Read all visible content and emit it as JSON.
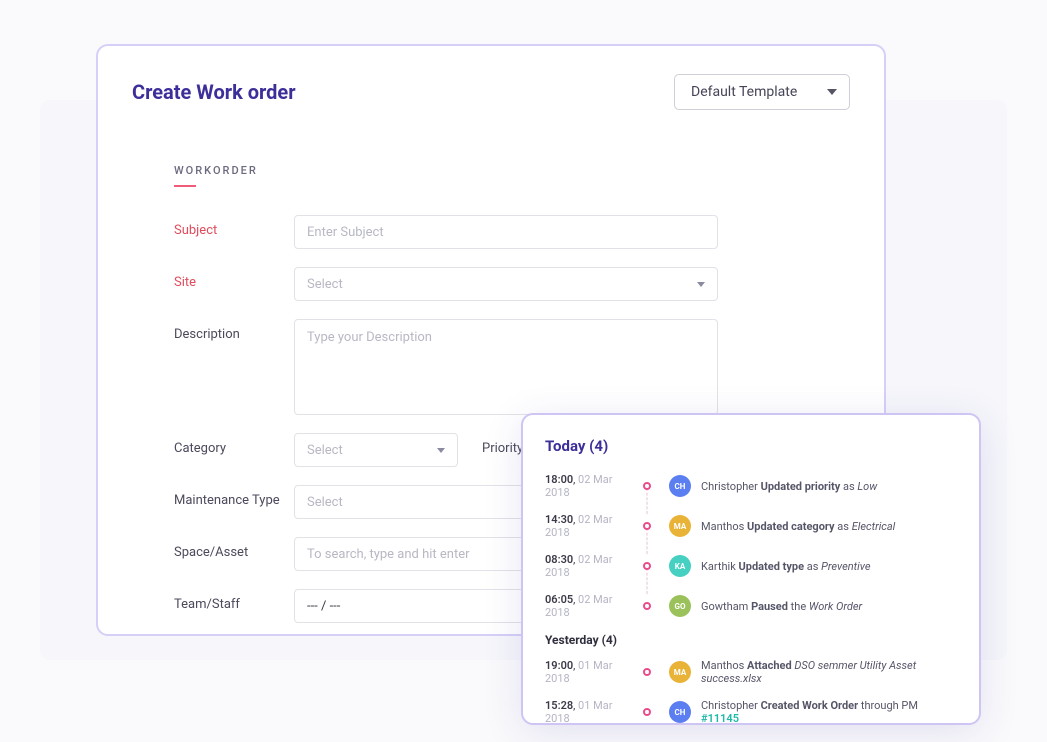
{
  "header": {
    "title": "Create Work order",
    "template_label": "Default Template"
  },
  "form": {
    "section_title": "WORKORDER",
    "fields": {
      "subject": {
        "label": "Subject",
        "placeholder": "Enter Subject"
      },
      "site": {
        "label": "Site",
        "placeholder": "Select"
      },
      "description": {
        "label": "Description",
        "placeholder": "Type your Description"
      },
      "category": {
        "label": "Category",
        "placeholder": "Select"
      },
      "priority": {
        "label": "Priority"
      },
      "maintenance_type": {
        "label": "Maintenance Type",
        "placeholder": "Select"
      },
      "space_asset": {
        "label": "Space/Asset",
        "placeholder": "To search, type and hit enter"
      },
      "team_staff": {
        "label": "Team/Staff",
        "value": "--- / ---"
      }
    }
  },
  "activity": {
    "today_header": "Today (4)",
    "yesterday_header": "Yesterday (4)",
    "today": [
      {
        "time": "18:00",
        "date": "02 Mar 2018",
        "initials": "CH",
        "color": "#5b7ef0",
        "name": "Christopher",
        "action": "Updated priority",
        "connector": "as",
        "value": "Low"
      },
      {
        "time": "14:30",
        "date": "02 Mar 2018",
        "initials": "MA",
        "color": "#e9b338",
        "name": "Manthos",
        "action": "Updated category",
        "connector": "as",
        "value": "Electrical"
      },
      {
        "time": "08:30",
        "date": "02 Mar 2018",
        "initials": "KA",
        "color": "#45d0c1",
        "name": "Karthik",
        "action": "Updated type",
        "connector": "as",
        "value": "Preventive"
      },
      {
        "time": "06:05",
        "date": "02 Mar 2018",
        "initials": "GO",
        "color": "#9bc25a",
        "name": "Gowtham",
        "action": "Paused",
        "connector": "the",
        "value": "Work Order"
      }
    ],
    "yesterday": [
      {
        "time": "19:00",
        "date": "01 Mar 2018",
        "initials": "MA",
        "color": "#e9b338",
        "name": "Manthos",
        "action": "Attached",
        "connector": "",
        "value": "DSO semmer Utility Asset success.xlsx"
      },
      {
        "time": "15:28",
        "date": "01 Mar 2018",
        "initials": "CH",
        "color": "#5b7ef0",
        "name": "Christopher",
        "action": "Created Work Order",
        "connector": "through PM",
        "link": "#11145"
      }
    ]
  }
}
